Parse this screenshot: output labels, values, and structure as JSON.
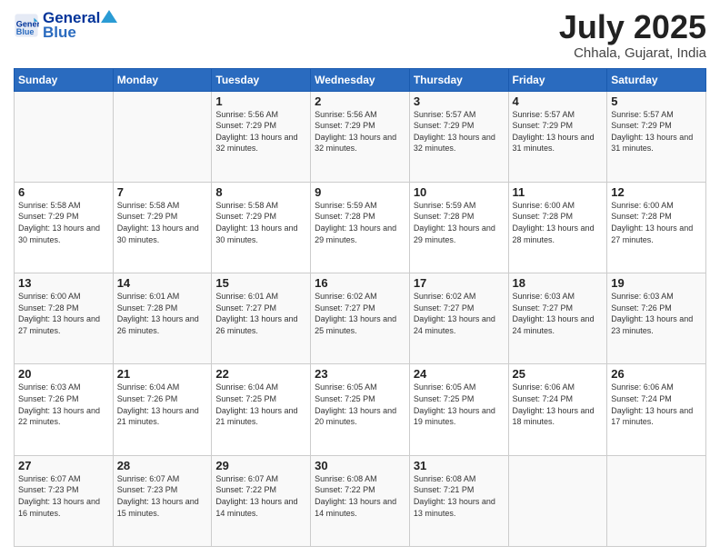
{
  "header": {
    "logo_general": "General",
    "logo_blue": "Blue",
    "month_title": "July 2025",
    "location": "Chhala, Gujarat, India"
  },
  "weekdays": [
    "Sunday",
    "Monday",
    "Tuesday",
    "Wednesday",
    "Thursday",
    "Friday",
    "Saturday"
  ],
  "weeks": [
    [
      {
        "day": "",
        "info": ""
      },
      {
        "day": "",
        "info": ""
      },
      {
        "day": "1",
        "info": "Sunrise: 5:56 AM\nSunset: 7:29 PM\nDaylight: 13 hours and 32 minutes."
      },
      {
        "day": "2",
        "info": "Sunrise: 5:56 AM\nSunset: 7:29 PM\nDaylight: 13 hours and 32 minutes."
      },
      {
        "day": "3",
        "info": "Sunrise: 5:57 AM\nSunset: 7:29 PM\nDaylight: 13 hours and 32 minutes."
      },
      {
        "day": "4",
        "info": "Sunrise: 5:57 AM\nSunset: 7:29 PM\nDaylight: 13 hours and 31 minutes."
      },
      {
        "day": "5",
        "info": "Sunrise: 5:57 AM\nSunset: 7:29 PM\nDaylight: 13 hours and 31 minutes."
      }
    ],
    [
      {
        "day": "6",
        "info": "Sunrise: 5:58 AM\nSunset: 7:29 PM\nDaylight: 13 hours and 30 minutes."
      },
      {
        "day": "7",
        "info": "Sunrise: 5:58 AM\nSunset: 7:29 PM\nDaylight: 13 hours and 30 minutes."
      },
      {
        "day": "8",
        "info": "Sunrise: 5:58 AM\nSunset: 7:29 PM\nDaylight: 13 hours and 30 minutes."
      },
      {
        "day": "9",
        "info": "Sunrise: 5:59 AM\nSunset: 7:28 PM\nDaylight: 13 hours and 29 minutes."
      },
      {
        "day": "10",
        "info": "Sunrise: 5:59 AM\nSunset: 7:28 PM\nDaylight: 13 hours and 29 minutes."
      },
      {
        "day": "11",
        "info": "Sunrise: 6:00 AM\nSunset: 7:28 PM\nDaylight: 13 hours and 28 minutes."
      },
      {
        "day": "12",
        "info": "Sunrise: 6:00 AM\nSunset: 7:28 PM\nDaylight: 13 hours and 27 minutes."
      }
    ],
    [
      {
        "day": "13",
        "info": "Sunrise: 6:00 AM\nSunset: 7:28 PM\nDaylight: 13 hours and 27 minutes."
      },
      {
        "day": "14",
        "info": "Sunrise: 6:01 AM\nSunset: 7:28 PM\nDaylight: 13 hours and 26 minutes."
      },
      {
        "day": "15",
        "info": "Sunrise: 6:01 AM\nSunset: 7:27 PM\nDaylight: 13 hours and 26 minutes."
      },
      {
        "day": "16",
        "info": "Sunrise: 6:02 AM\nSunset: 7:27 PM\nDaylight: 13 hours and 25 minutes."
      },
      {
        "day": "17",
        "info": "Sunrise: 6:02 AM\nSunset: 7:27 PM\nDaylight: 13 hours and 24 minutes."
      },
      {
        "day": "18",
        "info": "Sunrise: 6:03 AM\nSunset: 7:27 PM\nDaylight: 13 hours and 24 minutes."
      },
      {
        "day": "19",
        "info": "Sunrise: 6:03 AM\nSunset: 7:26 PM\nDaylight: 13 hours and 23 minutes."
      }
    ],
    [
      {
        "day": "20",
        "info": "Sunrise: 6:03 AM\nSunset: 7:26 PM\nDaylight: 13 hours and 22 minutes."
      },
      {
        "day": "21",
        "info": "Sunrise: 6:04 AM\nSunset: 7:26 PM\nDaylight: 13 hours and 21 minutes."
      },
      {
        "day": "22",
        "info": "Sunrise: 6:04 AM\nSunset: 7:25 PM\nDaylight: 13 hours and 21 minutes."
      },
      {
        "day": "23",
        "info": "Sunrise: 6:05 AM\nSunset: 7:25 PM\nDaylight: 13 hours and 20 minutes."
      },
      {
        "day": "24",
        "info": "Sunrise: 6:05 AM\nSunset: 7:25 PM\nDaylight: 13 hours and 19 minutes."
      },
      {
        "day": "25",
        "info": "Sunrise: 6:06 AM\nSunset: 7:24 PM\nDaylight: 13 hours and 18 minutes."
      },
      {
        "day": "26",
        "info": "Sunrise: 6:06 AM\nSunset: 7:24 PM\nDaylight: 13 hours and 17 minutes."
      }
    ],
    [
      {
        "day": "27",
        "info": "Sunrise: 6:07 AM\nSunset: 7:23 PM\nDaylight: 13 hours and 16 minutes."
      },
      {
        "day": "28",
        "info": "Sunrise: 6:07 AM\nSunset: 7:23 PM\nDaylight: 13 hours and 15 minutes."
      },
      {
        "day": "29",
        "info": "Sunrise: 6:07 AM\nSunset: 7:22 PM\nDaylight: 13 hours and 14 minutes."
      },
      {
        "day": "30",
        "info": "Sunrise: 6:08 AM\nSunset: 7:22 PM\nDaylight: 13 hours and 14 minutes."
      },
      {
        "day": "31",
        "info": "Sunrise: 6:08 AM\nSunset: 7:21 PM\nDaylight: 13 hours and 13 minutes."
      },
      {
        "day": "",
        "info": ""
      },
      {
        "day": "",
        "info": ""
      }
    ]
  ]
}
